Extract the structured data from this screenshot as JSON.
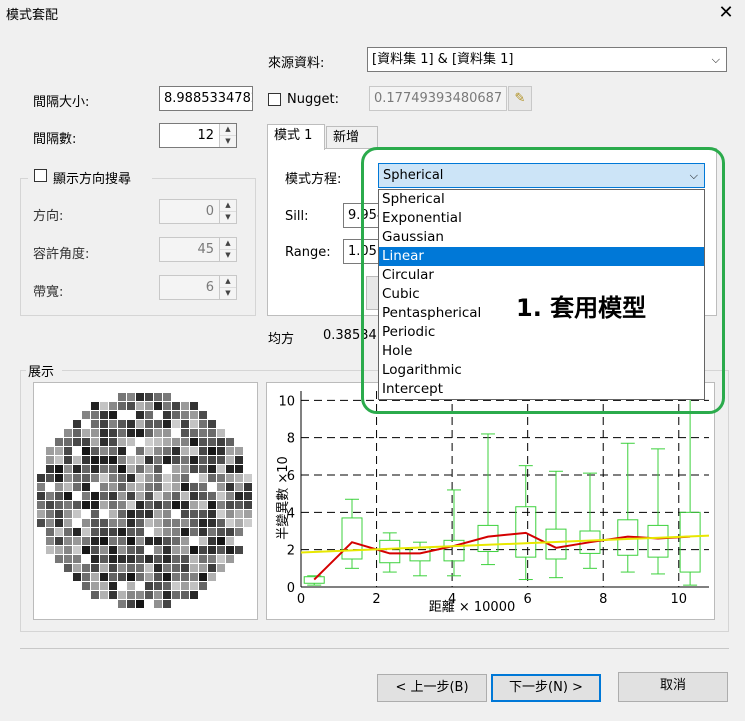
{
  "window": {
    "title": "模式套配",
    "close_label": "✕"
  },
  "source": {
    "label": "來源資料:",
    "value": "[資料集 1] & [資料集 1]"
  },
  "lag": {
    "size_label": "間隔大小:",
    "size_value": "8.98853347823",
    "count_label": "間隔數:",
    "count_value": "12"
  },
  "nugget": {
    "label": "Nugget:",
    "value": "0.17749393480687",
    "checked": false
  },
  "direction": {
    "checkbox_label": "顯示方向搜尋",
    "direction_label": "方向:",
    "direction_value": "0",
    "tolerance_label": "容許角度:",
    "tolerance_value": "45",
    "bandwidth_label": "帶寬:",
    "bandwidth_value": "6"
  },
  "tabs": [
    {
      "label": "模式 1"
    },
    {
      "label": "新增"
    }
  ],
  "model": {
    "equation_label": "模式方程:",
    "equation_value": "Spherical",
    "sill_label": "Sill:",
    "sill_value": "9.954",
    "range_label": "Range:",
    "range_value": "1.056"
  },
  "dropdown_options": [
    "Spherical",
    "Exponential",
    "Gaussian",
    "Linear",
    "Circular",
    "Cubic",
    "Pentaspherical",
    "Periodic",
    "Hole",
    "Logarithmic",
    "Intercept"
  ],
  "dropdown_highlighted": "Linear",
  "mean": {
    "label": "均方",
    "value": "0.38534"
  },
  "display": {
    "label": "展示"
  },
  "annotation": {
    "text": "1. 套用模型",
    "color": "#2bab4c"
  },
  "chart_data": {
    "type": "box",
    "xlabel": "距離 × 10000",
    "ylabel": "半變異數 ×10",
    "xlim": [
      0,
      10.8
    ],
    "ylim": [
      0,
      10.5
    ],
    "xticks": [
      "0",
      "2",
      "4",
      "6",
      "8",
      "10"
    ],
    "yticks": [
      "0",
      "2",
      "4",
      "6",
      "8",
      "10"
    ],
    "boxes": [
      {
        "x": 0.35,
        "q1": 0.2,
        "q3": 0.55,
        "lo": 0.1,
        "hi": 0.6
      },
      {
        "x": 1.35,
        "q1": 1.5,
        "q3": 3.7,
        "lo": 1.0,
        "hi": 4.7
      },
      {
        "x": 2.35,
        "q1": 1.3,
        "q3": 2.5,
        "lo": 0.8,
        "hi": 2.9
      },
      {
        "x": 3.15,
        "q1": 1.4,
        "q3": 2.1,
        "lo": 0.6,
        "hi": 2.4
      },
      {
        "x": 4.05,
        "q1": 1.4,
        "q3": 2.5,
        "lo": 0.6,
        "hi": 5.2
      },
      {
        "x": 4.95,
        "q1": 1.9,
        "q3": 3.3,
        "lo": 1.2,
        "hi": 8.2
      },
      {
        "x": 5.95,
        "q1": 1.6,
        "q3": 4.3,
        "lo": 0.4,
        "hi": 6.5
      },
      {
        "x": 6.75,
        "q1": 1.5,
        "q3": 3.1,
        "lo": 0.5,
        "hi": 6.2
      },
      {
        "x": 7.65,
        "q1": 1.8,
        "q3": 3.0,
        "lo": 1.0,
        "hi": 6.1
      },
      {
        "x": 8.65,
        "q1": 1.7,
        "q3": 3.6,
        "lo": 0.8,
        "hi": 7.7
      },
      {
        "x": 9.45,
        "q1": 1.6,
        "q3": 3.3,
        "lo": 0.7,
        "hi": 7.4
      },
      {
        "x": 10.3,
        "q1": 0.8,
        "q3": 4.0,
        "lo": 0.1,
        "hi": 10.5
      }
    ],
    "series": [
      {
        "color": "#d40000",
        "x": [
          0.35,
          1.35,
          2.35,
          3.15,
          4.05,
          4.95,
          5.95,
          6.75,
          7.65,
          8.65,
          9.45,
          10.3
        ],
        "y": [
          0.4,
          2.4,
          1.8,
          1.8,
          2.2,
          2.7,
          2.9,
          2.1,
          2.4,
          2.7,
          2.6,
          2.7
        ]
      },
      {
        "color": "#e8e800",
        "x": [
          0,
          10.8
        ],
        "y": [
          1.85,
          2.75
        ]
      }
    ],
    "grid": true
  },
  "buttons": {
    "back": "< 上一步(B)",
    "next": "下一步(N) >",
    "cancel": "取消"
  }
}
